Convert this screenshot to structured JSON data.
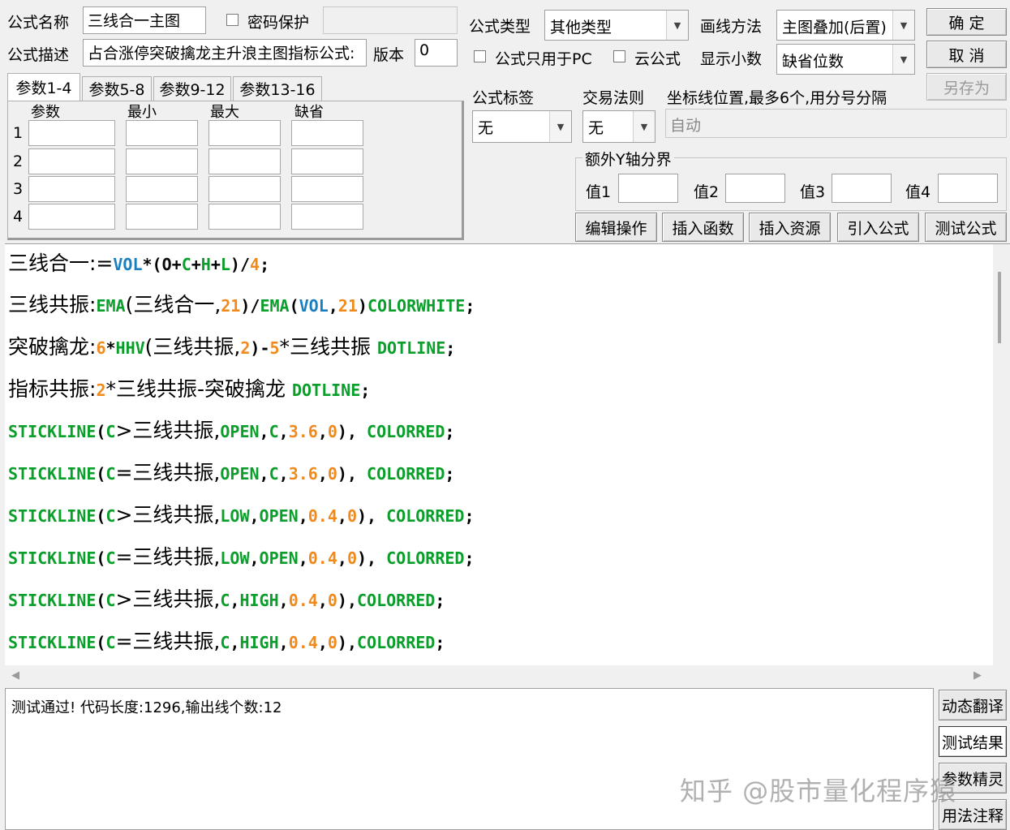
{
  "top": {
    "name_label": "公式名称",
    "name_value": "三线合一主图",
    "password_label": "密码保护",
    "desc_label": "公式描述",
    "desc_value": "占合涨停突破擒龙主升浪主图指标公式:",
    "version_label": "版本",
    "version_value": "0",
    "type_label": "公式类型",
    "type_value": "其他类型",
    "draw_label": "画线方法",
    "draw_value": "主图叠加(后置)",
    "pc_only_label": "公式只用于PC",
    "cloud_label": "云公式",
    "decimals_label": "显示小数",
    "decimals_value": "缺省位数",
    "ok_label": "确  定",
    "cancel_label": "取  消",
    "saveas_label": "另存为"
  },
  "params": {
    "tabs": [
      "参数1-4",
      "参数5-8",
      "参数9-12",
      "参数13-16"
    ],
    "headers": [
      "参数",
      "最小",
      "最大",
      "缺省"
    ],
    "rows": [
      "1",
      "2",
      "3",
      "4"
    ]
  },
  "right": {
    "tag_label": "公式标签",
    "tag_value": "无",
    "rule_label": "交易法则",
    "rule_value": "无",
    "axis_label": "坐标线位置,最多6个,用分号分隔",
    "axis_value": "自动",
    "yaxis_group": "额外Y轴分界",
    "values": [
      "值1",
      "值2",
      "值3",
      "值4"
    ],
    "buttons": [
      "编辑操作",
      "插入函数",
      "插入资源",
      "引入公式",
      "测试公式"
    ]
  },
  "code_lines": [
    [
      [
        "三线合一:=",
        "#000"
      ],
      [
        "VOL",
        "#1a7fc1"
      ],
      [
        "*(",
        "#000"
      ],
      [
        "O",
        "#0a0a0a"
      ],
      [
        "+",
        "#000"
      ],
      [
        "C",
        "#0a9e2a"
      ],
      [
        "+",
        "#000"
      ],
      [
        "H",
        "#0a9e2a"
      ],
      [
        "+",
        "#000"
      ],
      [
        "L",
        "#0a9e2a"
      ],
      [
        ")/",
        "#000"
      ],
      [
        "4",
        "#f08a1c"
      ],
      [
        ";",
        "#000"
      ]
    ],
    [
      [
        "三线共振:",
        "#000"
      ],
      [
        "EMA",
        "#0a9e2a"
      ],
      [
        "(三线合一,",
        "#000"
      ],
      [
        "21",
        "#f08a1c"
      ],
      [
        ")/",
        "#000"
      ],
      [
        "EMA",
        "#0a9e2a"
      ],
      [
        "(",
        "#000"
      ],
      [
        "VOL",
        "#1a7fc1"
      ],
      [
        ",",
        "#000"
      ],
      [
        "21",
        "#f08a1c"
      ],
      [
        ")",
        "#000"
      ],
      [
        "COLORWHITE",
        "#0a9e2a"
      ],
      [
        ";",
        "#000"
      ]
    ],
    [
      [
        "突破擒龙:",
        "#000"
      ],
      [
        "6",
        "#f08a1c"
      ],
      [
        "*",
        "#000"
      ],
      [
        "HHV",
        "#0a9e2a"
      ],
      [
        "(三线共振,",
        "#000"
      ],
      [
        "2",
        "#f08a1c"
      ],
      [
        ")-",
        "#000"
      ],
      [
        "5",
        "#f08a1c"
      ],
      [
        "*三线共振 ",
        "#000"
      ],
      [
        "DOTLINE",
        "#0a9e2a"
      ],
      [
        ";",
        "#000"
      ]
    ],
    [
      [
        "指标共振:",
        "#000"
      ],
      [
        "2",
        "#f08a1c"
      ],
      [
        "*三线共振-突破擒龙 ",
        "#000"
      ],
      [
        "DOTLINE",
        "#0a9e2a"
      ],
      [
        ";",
        "#000"
      ]
    ],
    [
      [
        "STICKLINE",
        "#0a9e2a"
      ],
      [
        "(",
        "#000"
      ],
      [
        "C",
        "#0a9e2a"
      ],
      [
        ">三线共振,",
        "#000"
      ],
      [
        "OPEN",
        "#0a9e2a"
      ],
      [
        ",",
        "#000"
      ],
      [
        "C",
        "#0a9e2a"
      ],
      [
        ",",
        "#000"
      ],
      [
        "3.6",
        "#f08a1c"
      ],
      [
        ",",
        "#000"
      ],
      [
        "0",
        "#f08a1c"
      ],
      [
        "), ",
        "#000"
      ],
      [
        "COLORRED",
        "#0a9e2a"
      ],
      [
        ";",
        "#000"
      ]
    ],
    [
      [
        "STICKLINE",
        "#0a9e2a"
      ],
      [
        "(",
        "#000"
      ],
      [
        "C",
        "#0a9e2a"
      ],
      [
        "=三线共振,",
        "#000"
      ],
      [
        "OPEN",
        "#0a9e2a"
      ],
      [
        ",",
        "#000"
      ],
      [
        "C",
        "#0a9e2a"
      ],
      [
        ",",
        "#000"
      ],
      [
        "3.6",
        "#f08a1c"
      ],
      [
        ",",
        "#000"
      ],
      [
        "0",
        "#f08a1c"
      ],
      [
        "), ",
        "#000"
      ],
      [
        "COLORRED",
        "#0a9e2a"
      ],
      [
        ";",
        "#000"
      ]
    ],
    [
      [
        "STICKLINE",
        "#0a9e2a"
      ],
      [
        "(",
        "#000"
      ],
      [
        "C",
        "#0a9e2a"
      ],
      [
        ">三线共振,",
        "#000"
      ],
      [
        "LOW",
        "#0a9e2a"
      ],
      [
        ",",
        "#000"
      ],
      [
        "OPEN",
        "#0a9e2a"
      ],
      [
        ",",
        "#000"
      ],
      [
        "0.4",
        "#f08a1c"
      ],
      [
        ",",
        "#000"
      ],
      [
        "0",
        "#f08a1c"
      ],
      [
        "), ",
        "#000"
      ],
      [
        "COLORRED",
        "#0a9e2a"
      ],
      [
        ";",
        "#000"
      ]
    ],
    [
      [
        "STICKLINE",
        "#0a9e2a"
      ],
      [
        "(",
        "#000"
      ],
      [
        "C",
        "#0a9e2a"
      ],
      [
        "=三线共振,",
        "#000"
      ],
      [
        "LOW",
        "#0a9e2a"
      ],
      [
        ",",
        "#000"
      ],
      [
        "OPEN",
        "#0a9e2a"
      ],
      [
        ",",
        "#000"
      ],
      [
        "0.4",
        "#f08a1c"
      ],
      [
        ",",
        "#000"
      ],
      [
        "0",
        "#f08a1c"
      ],
      [
        "), ",
        "#000"
      ],
      [
        "COLORRED",
        "#0a9e2a"
      ],
      [
        ";",
        "#000"
      ]
    ],
    [
      [
        "STICKLINE",
        "#0a9e2a"
      ],
      [
        "(",
        "#000"
      ],
      [
        "C",
        "#0a9e2a"
      ],
      [
        ">三线共振,",
        "#000"
      ],
      [
        "C",
        "#0a9e2a"
      ],
      [
        ",",
        "#000"
      ],
      [
        "HIGH",
        "#0a9e2a"
      ],
      [
        ",",
        "#000"
      ],
      [
        "0.4",
        "#f08a1c"
      ],
      [
        ",",
        "#000"
      ],
      [
        "0",
        "#f08a1c"
      ],
      [
        "),",
        "#000"
      ],
      [
        "COLORRED",
        "#0a9e2a"
      ],
      [
        ";",
        "#000"
      ]
    ],
    [
      [
        "STICKLINE",
        "#0a9e2a"
      ],
      [
        "(",
        "#000"
      ],
      [
        "C",
        "#0a9e2a"
      ],
      [
        "=三线共振,",
        "#000"
      ],
      [
        "C",
        "#0a9e2a"
      ],
      [
        ",",
        "#000"
      ],
      [
        "HIGH",
        "#0a9e2a"
      ],
      [
        ",",
        "#000"
      ],
      [
        "0.4",
        "#f08a1c"
      ],
      [
        ",",
        "#000"
      ],
      [
        "0",
        "#f08a1c"
      ],
      [
        "),",
        "#000"
      ],
      [
        "COLORRED",
        "#0a9e2a"
      ],
      [
        ";",
        "#000"
      ]
    ]
  ],
  "output": {
    "message": "测试通过! 代码长度:1296,输出线个数:12"
  },
  "side_buttons": [
    "动态翻译",
    "测试结果",
    "参数精灵",
    "用法注释"
  ],
  "watermark": "知乎 @股市量化程序猿"
}
